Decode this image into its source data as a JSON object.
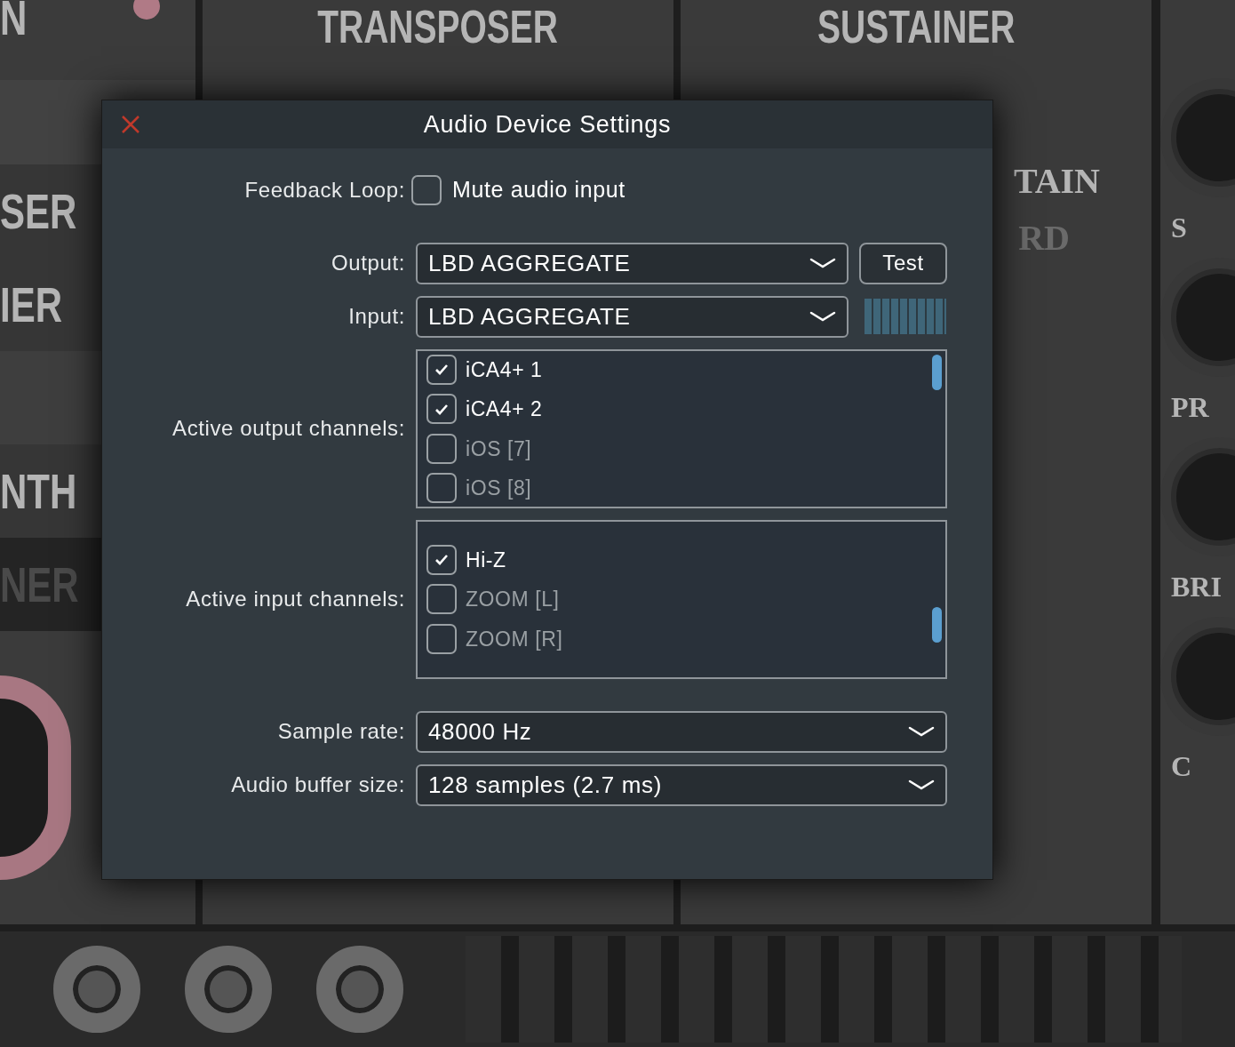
{
  "background": {
    "headers": [
      "N",
      "TRANSPOSER",
      "SUSTAINER"
    ],
    "left_items": [
      "SER",
      "IER",
      "NTH",
      "NER"
    ],
    "sustain_labels": [
      "TAIN",
      "RD"
    ],
    "right_labels": [
      "S",
      "PR",
      "BRI",
      "C"
    ]
  },
  "dialog": {
    "title": "Audio Device Settings",
    "feedback": {
      "label": "Feedback Loop:",
      "option": "Mute audio input",
      "checked": false
    },
    "output": {
      "label": "Output:",
      "value": "LBD AGGREGATE",
      "button": "Test"
    },
    "input": {
      "label": "Input:",
      "value": "LBD AGGREGATE",
      "level": 0
    },
    "output_channels": {
      "label": "Active output channels:",
      "items": [
        {
          "name": "iCA4+ 1",
          "checked": true
        },
        {
          "name": "iCA4+ 2",
          "checked": true
        },
        {
          "name": "iOS [7]",
          "checked": false
        },
        {
          "name": "iOS [8]",
          "checked": false
        }
      ]
    },
    "input_channels": {
      "label": "Active input channels:",
      "items": [
        {
          "name": "Hi-Z",
          "checked": true
        },
        {
          "name": "ZOOM [L]",
          "checked": false
        },
        {
          "name": "ZOOM [R]",
          "checked": false
        }
      ]
    },
    "sample_rate": {
      "label": "Sample rate:",
      "value": "48000 Hz"
    },
    "buffer_size": {
      "label": "Audio buffer size:",
      "value": "128 samples (2.7 ms)"
    }
  }
}
